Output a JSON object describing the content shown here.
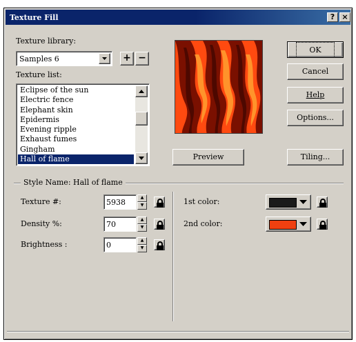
{
  "window": {
    "title": "Texture Fill",
    "help_glyph": "?",
    "close_glyph": "×"
  },
  "library": {
    "label": "Texture library:",
    "selected": "Samples 6",
    "add_glyph": "+",
    "remove_glyph": "−"
  },
  "texture_list": {
    "label": "Texture list:",
    "items": [
      "Eclipse of the sun",
      "Electric fence",
      "Elephant skin",
      "Epidermis",
      "Evening ripple",
      "Exhaust fumes",
      "Gingham",
      "Hall of flame"
    ],
    "selected_index": 7
  },
  "buttons": {
    "ok": "OK",
    "cancel": "Cancel",
    "help": "Help",
    "options": "Options...",
    "preview": "Preview",
    "tiling": "Tiling..."
  },
  "style": {
    "label": "Style Name: Hall of flame",
    "texture_label": "Texture #:",
    "texture_value": "5938",
    "density_label": "Density %:",
    "density_value": "70",
    "brightness_label": "Brightness  :",
    "brightness_value": "0",
    "color1_label": "1st color:",
    "color1": "#1a1a1a",
    "color2_label": "2nd color:",
    "color2": "#f04010"
  },
  "icons": {
    "dropdown": "chevron-down-icon",
    "lock": "lock-icon",
    "scroll_up": "arrow-up-icon",
    "scroll_down": "arrow-down-icon"
  }
}
